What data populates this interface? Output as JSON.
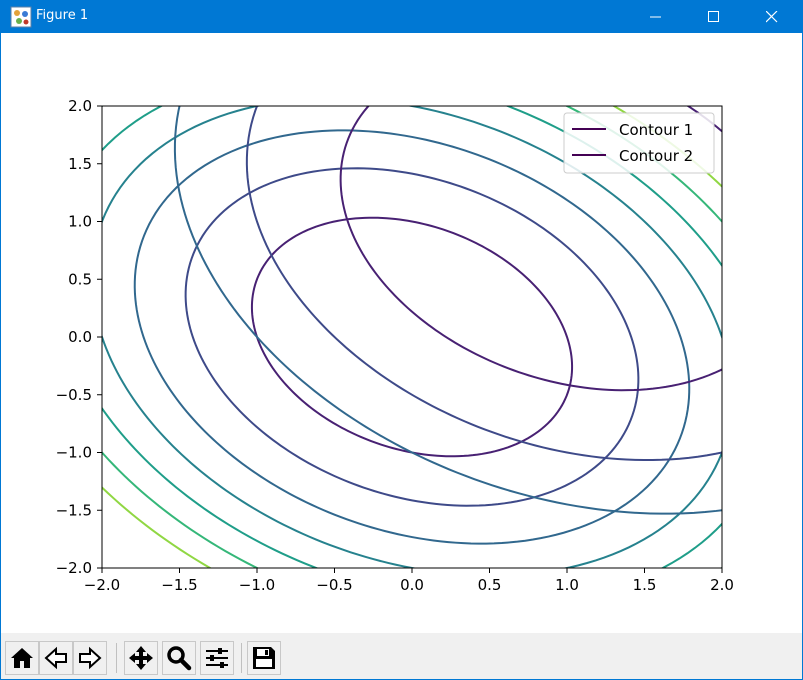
{
  "window": {
    "title": "Figure 1",
    "accent": "#0078d4"
  },
  "toolbar": {
    "buttons": [
      {
        "name": "home",
        "icon": "home-icon"
      },
      {
        "name": "back",
        "icon": "back-arrow-icon"
      },
      {
        "name": "forward",
        "icon": "forward-arrow-icon"
      },
      {
        "name": "pan",
        "icon": "move-icon"
      },
      {
        "name": "zoom",
        "icon": "magnifier-icon"
      },
      {
        "name": "configure-subplots",
        "icon": "sliders-icon"
      },
      {
        "name": "save",
        "icon": "floppy-disk-icon"
      }
    ]
  },
  "chart_data": {
    "type": "line",
    "subtype": "contour",
    "title": "",
    "xlabel": "",
    "ylabel": "",
    "xlim": [
      -2.0,
      2.0
    ],
    "ylim": [
      -2.0,
      2.0
    ],
    "x_ticks": [
      "−2.0",
      "−1.5",
      "−1.0",
      "−0.5",
      "0.0",
      "0.5",
      "1.0",
      "1.5",
      "2.0"
    ],
    "y_ticks": [
      "2.0",
      "1.5",
      "1.0",
      "0.5",
      "0.0",
      "−0.5",
      "−1.0",
      "−1.5",
      "−2.0"
    ],
    "grid": false,
    "legend_position": "top-right",
    "series": [
      {
        "name": "Contour 1",
        "function": "x^2 + y^2 + 0.5*x*y",
        "center": [
          0,
          0
        ],
        "levels": [
          1,
          2,
          3,
          4,
          5,
          6,
          7
        ],
        "colors": [
          "#482173",
          "#3e4a89",
          "#31688e",
          "#26828e",
          "#1f9e89",
          "#35b779",
          "#90d743"
        ]
      },
      {
        "name": "Contour 2",
        "function": "(x-1)^2 + (y-1)^2 + 0.5*(x-1)*(y-1)",
        "center": [
          1,
          1
        ],
        "levels": [
          2,
          4,
          6
        ],
        "colors": [
          "#482173",
          "#3e4a89",
          "#31688e"
        ]
      }
    ],
    "legend_color": "#440154"
  }
}
